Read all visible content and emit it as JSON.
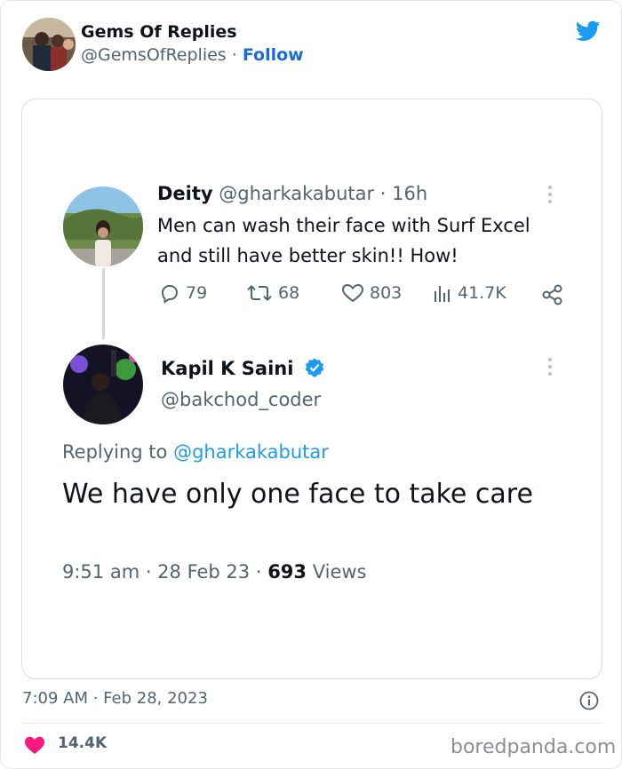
{
  "header": {
    "name": "Gems Of Replies",
    "handle": "@GemsOfReplies",
    "separator": " · ",
    "follow_label": "Follow"
  },
  "embedded_screenshot": {
    "tweet1": {
      "name": "Deity",
      "handle_time": "@gharkakabutar · 16h",
      "text": "Men can wash their face with Surf Excel and still have better skin!! How!",
      "replies": "79",
      "retweets": "68",
      "likes": "803",
      "views": "41.7K"
    },
    "tweet2": {
      "name": "Kapil K Saini",
      "handle": "@bakchod_coder",
      "replying_prefix": "Replying to ",
      "replying_to": "@gharkakabutar",
      "text": "We have only one face to take care",
      "meta_prefix": "9:51 am · 28 Feb 23 · ",
      "views_count": "693",
      "views_label": " Views"
    }
  },
  "footer": {
    "timestamp": "7:09 AM · Feb 28, 2023",
    "likes": "14.4K",
    "watermark": "boredpanda.com"
  },
  "icons": {
    "twitter": "twitter-bird-icon",
    "info": "info-icon",
    "heart": "heart-icon",
    "reply": "reply-icon",
    "retweet": "retweet-icon",
    "like": "like-icon",
    "views": "views-icon",
    "share": "share-icon",
    "verified": "verified-badge-icon",
    "more": "more-icon"
  },
  "colors": {
    "follow": "#1d6bd8",
    "twitter_blue": "#1d9bf0",
    "heart": "#f91880",
    "muted": "#536471"
  }
}
